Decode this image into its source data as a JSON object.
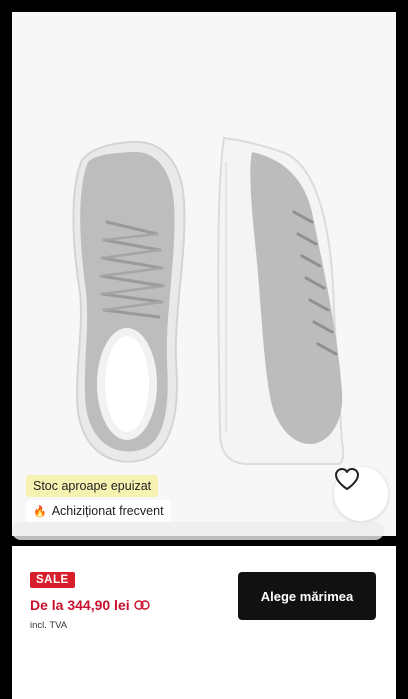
{
  "product": {
    "badges": {
      "low_stock": "Stoc aproape epuizat",
      "frequently_bought": "Achiziționat frecvent",
      "fire_icon": "fire-icon"
    },
    "image_alt": "grey-suede-sneakers"
  },
  "purchase_bar": {
    "sale_label": "SALE",
    "price": "De la 344,90 lei",
    "vat_note": "incl. TVA",
    "select_size_button": "Alege mărimea",
    "info_icon": "price-info-icon"
  },
  "wishlist": {
    "icon": "heart-icon"
  },
  "colors": {
    "sale_red": "#d81e2b",
    "price_red": "#c8102e",
    "low_stock_bg": "#f6f2b2",
    "cta_bg": "#111111"
  }
}
